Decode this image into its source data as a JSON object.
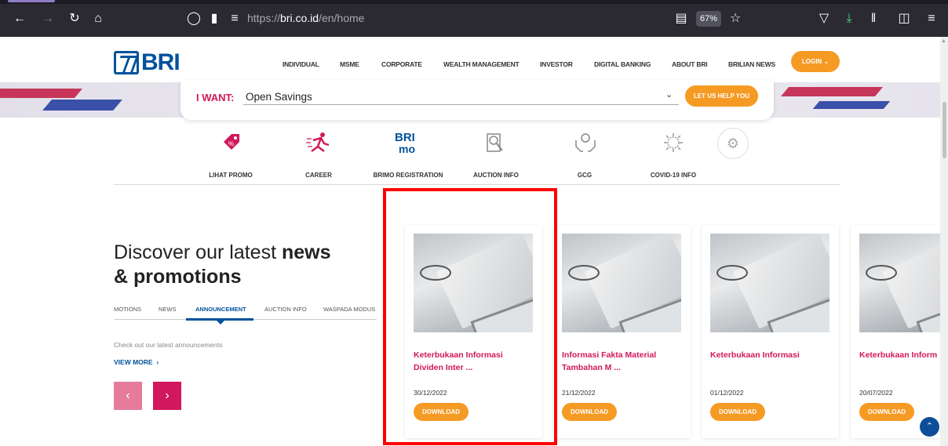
{
  "browser": {
    "url_prefix": "https://",
    "url_domain": "bri.co.id",
    "url_path": "/en/home",
    "zoom": "67%"
  },
  "brand": {
    "logo_text": "BRI"
  },
  "nav": {
    "items": [
      "INDIVIDUAL",
      "MSME",
      "CORPORATE",
      "WEALTH MANAGEMENT",
      "INVESTOR",
      "DIGITAL BANKING",
      "ABOUT BRI",
      "BRILIAN NEWS"
    ],
    "login": "LOGIN"
  },
  "iwant": {
    "label": "I WANT:",
    "value": "Open Savings",
    "button": "LET US HELP YOU"
  },
  "quicklinks": [
    "LIHAT PROMO",
    "CAREER",
    "BRIMO REGISTRATION",
    "AUCTION INFO",
    "GCG",
    "COVID-19 INFO"
  ],
  "discover": {
    "title_a": "Discover our latest ",
    "title_b": "news",
    "title_c": "& promotions",
    "tabs": [
      "MOTIONS",
      "NEWS",
      "ANNOUNCEMENT",
      "AUCTION INFO",
      "WASPADA MODUS"
    ],
    "subtitle": "Check out our latest announcements",
    "view_more": "VIEW MORE"
  },
  "cards": [
    {
      "title1": "Keterbukaan Informasi",
      "title2": "Dividen Inter ...",
      "date": "30/12/2022",
      "button": "DOWNLOAD"
    },
    {
      "title1": "Informasi Fakta Material",
      "title2": "Tambahan M ...",
      "date": "21/12/2022",
      "button": "DOWNLOAD"
    },
    {
      "title1": "Keterbukaan Informasi",
      "title2": "",
      "date": "01/12/2022",
      "button": "DOWNLOAD"
    },
    {
      "title1": "Keterbukaan Inform",
      "title2": "",
      "date": "20/07/2022",
      "button": "DOWNLOAD"
    }
  ],
  "colors": {
    "brand_blue": "#00529c",
    "accent_orange": "#f59a23",
    "accent_pink": "#d1185c",
    "highlight": "#ff0000"
  }
}
